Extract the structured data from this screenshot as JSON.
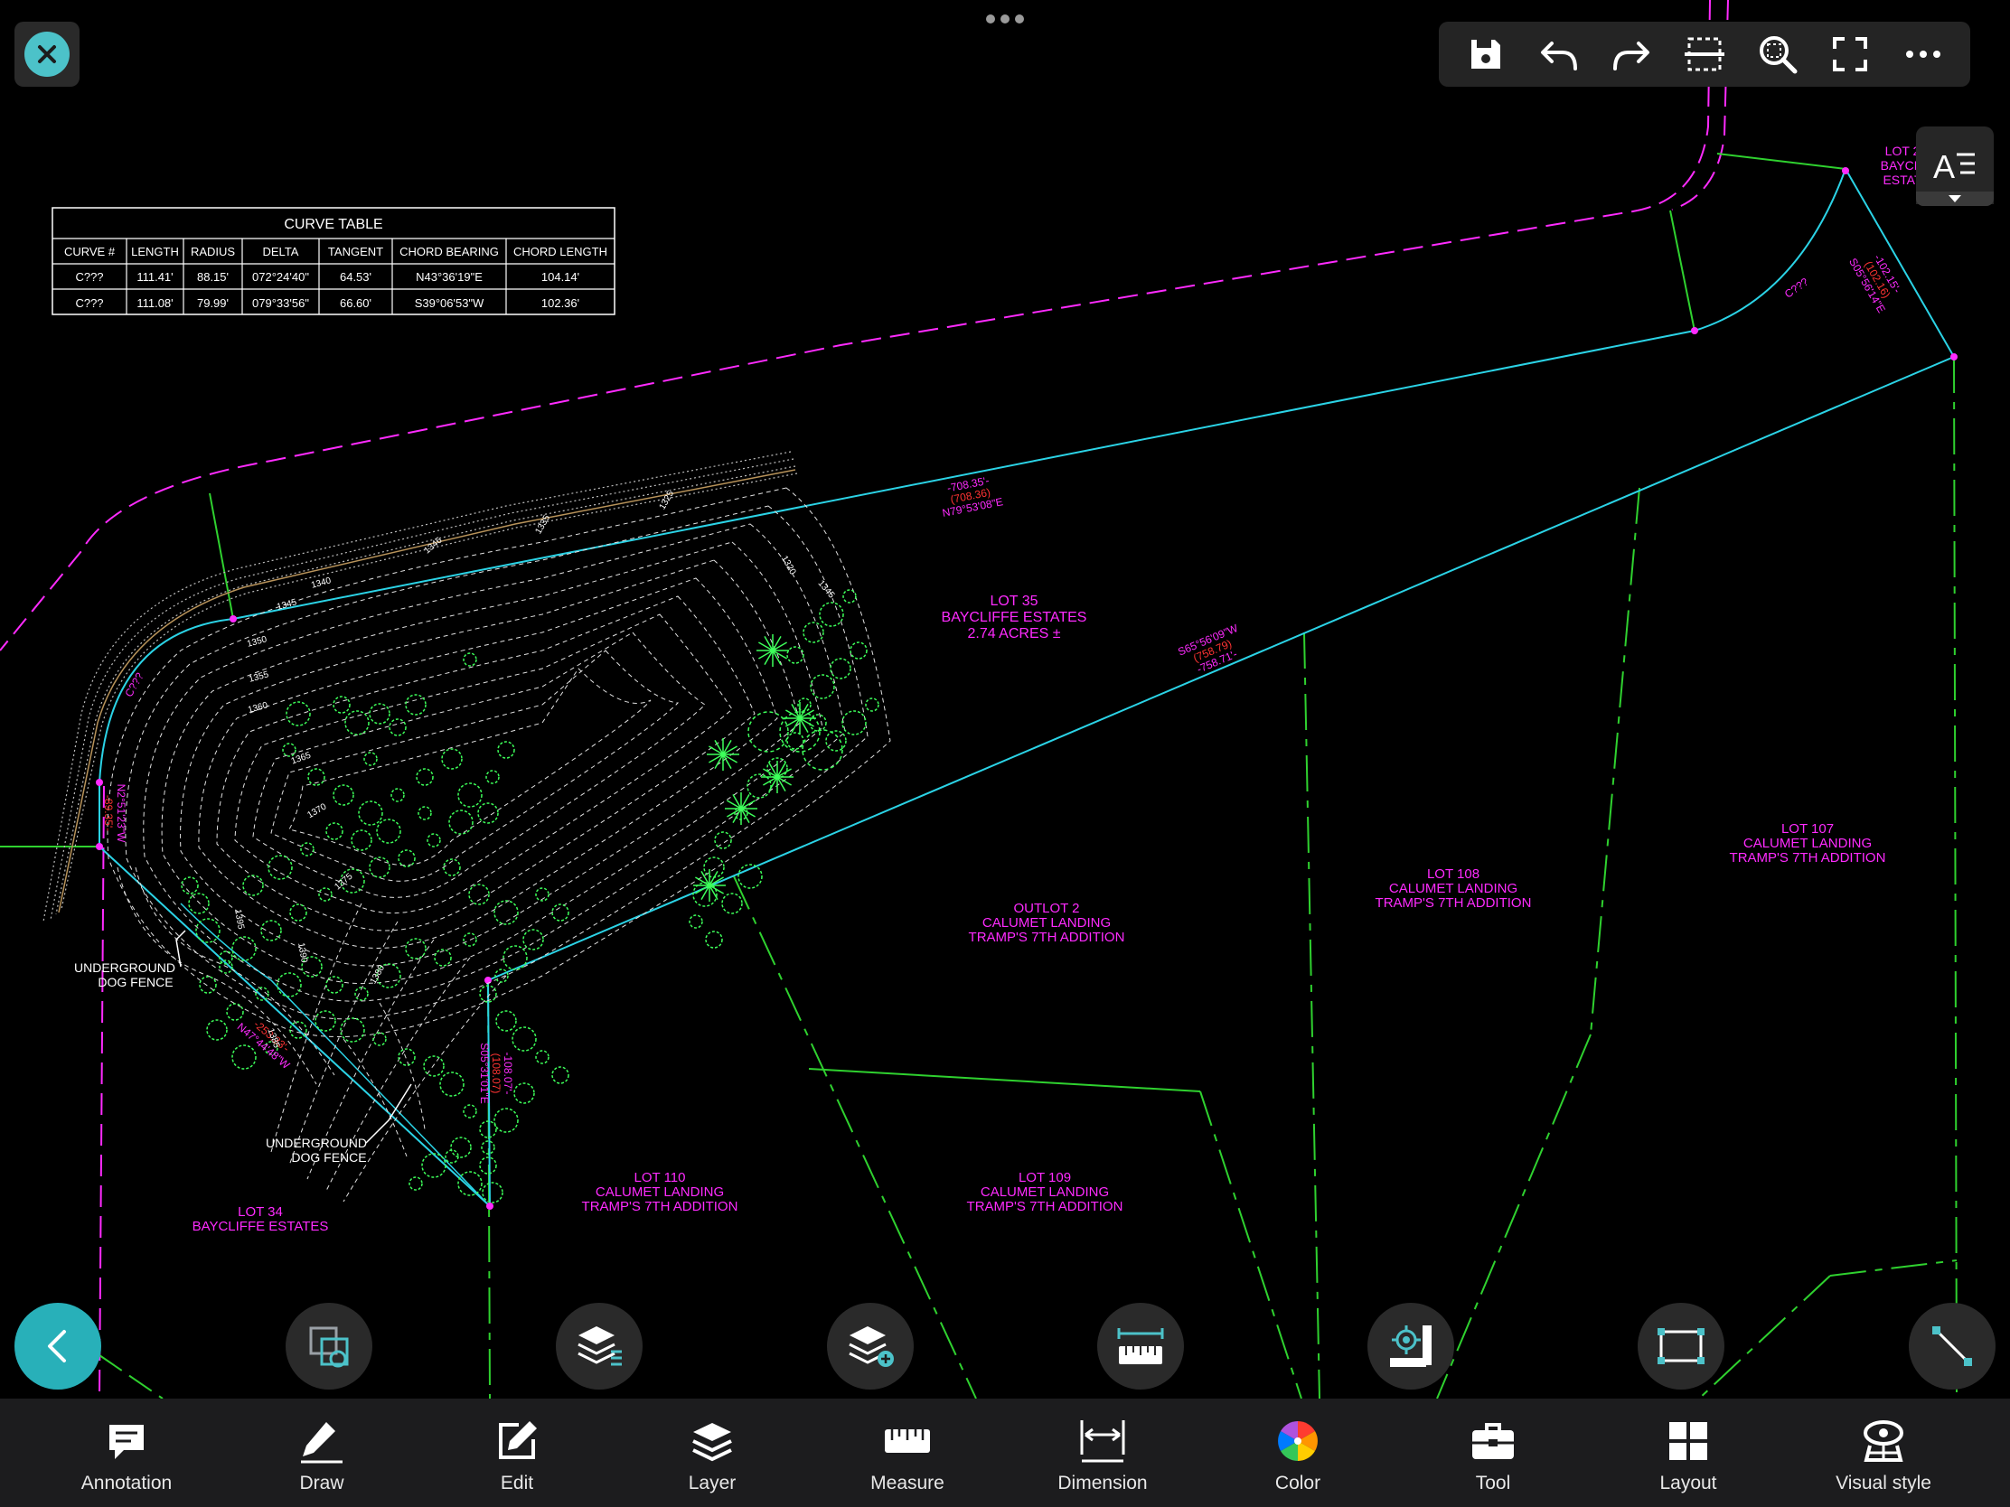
{
  "top_toolbar": {
    "buttons": [
      {
        "name": "save-button",
        "icon": "save-icon"
      },
      {
        "name": "undo-button",
        "icon": "undo-icon"
      },
      {
        "name": "redo-button",
        "icon": "redo-icon"
      },
      {
        "name": "trim-button",
        "icon": "trim-icon"
      },
      {
        "name": "zoom-extents-button",
        "icon": "zoom-icon"
      },
      {
        "name": "fullscreen-button",
        "icon": "fullscreen-icon"
      },
      {
        "name": "more-button",
        "icon": "more-icon"
      }
    ]
  },
  "curve_table": {
    "title": "CURVE TABLE",
    "headers": [
      "CURVE #",
      "LENGTH",
      "RADIUS",
      "DELTA",
      "TANGENT",
      "CHORD BEARING",
      "CHORD LENGTH"
    ],
    "rows": [
      [
        "C???",
        "111.41'",
        "88.15'",
        "072°24'40\"",
        "64.53'",
        "N43°36'19\"E",
        "104.14'"
      ],
      [
        "C???",
        "111.08'",
        "79.99'",
        "079°33'56\"",
        "66.60'",
        "S39°06'53\"W",
        "102.36'"
      ]
    ]
  },
  "labels": {
    "lot35": [
      "LOT 35",
      "BAYCLIFFE ESTATES",
      "2.74 ACRES ±"
    ],
    "lot34": [
      "LOT 34",
      "BAYCLIFFE ESTATES"
    ],
    "lot_top": [
      "LOT 2",
      "BAYCLI",
      "ESTAT"
    ],
    "outlot2": [
      "OUTLOT 2",
      "CALUMET LANDING",
      "TRAMP'S 7TH ADDITION"
    ],
    "lot108": [
      "LOT 108",
      "CALUMET LANDING",
      "TRAMP'S 7TH ADDITION"
    ],
    "lot107": [
      "LOT 107",
      "CALUMET LANDING",
      "TRAMP'S 7TH ADDITION"
    ],
    "lot110": [
      "LOT 110",
      "CALUMET LANDING",
      "TRAMP'S 7TH ADDITION"
    ],
    "lot109": [
      "LOT 109",
      "CALUMET LANDING",
      "TRAMP'S 7TH ADDITION"
    ],
    "fence1": [
      "UNDERGROUND",
      "DOG FENCE"
    ],
    "fence2": [
      "UNDERGROUND",
      "DOG FENCE"
    ],
    "curve1": "C???",
    "curve2": "C???",
    "dim_north": [
      "-708.35'-",
      "(708.36)",
      "N79°53'08\"E"
    ],
    "dim_south": [
      "S65°56'09\"W",
      "(758.79)",
      "-758.71'-"
    ],
    "dim_ne": [
      "-102.15'-",
      "(102.16)",
      "S05°56'14\"E"
    ],
    "dim_w": [
      "N2°51'23\"W",
      "-89.35'-"
    ],
    "dim_sw": [
      "-253.33'-",
      "N47°44'48\"W"
    ],
    "dim_s": [
      "-108.07'-",
      "(108.07)",
      "S05°31'01\"E"
    ],
    "contours": [
      "1345",
      "1340",
      "1350",
      "1355",
      "1360",
      "1365",
      "1370",
      "1375",
      "1380",
      "1385",
      "1390",
      "1395",
      "1335",
      "1325",
      "1320",
      "1345",
      "1346"
    ]
  },
  "floating_tools": [
    {
      "name": "select-objects-button",
      "icon": "select-icon"
    },
    {
      "name": "layer-manager-button",
      "icon": "layers-list-icon"
    },
    {
      "name": "add-layer-button",
      "icon": "layers-add-icon"
    },
    {
      "name": "quick-measure-button",
      "icon": "ruler-icon"
    },
    {
      "name": "settings-tool-button",
      "icon": "settings-ruler-icon"
    },
    {
      "name": "rectangle-button",
      "icon": "rectangle-icon"
    },
    {
      "name": "line-button",
      "icon": "line-icon"
    }
  ],
  "bottom_bar": [
    {
      "name": "annotation",
      "label": "Annotation",
      "icon": "annotation-icon"
    },
    {
      "name": "draw",
      "label": "Draw",
      "icon": "pencil-icon"
    },
    {
      "name": "edit",
      "label": "Edit",
      "icon": "edit-icon"
    },
    {
      "name": "layer",
      "label": "Layer",
      "icon": "layer-icon"
    },
    {
      "name": "measure",
      "label": "Measure",
      "icon": "measure-icon"
    },
    {
      "name": "dimension",
      "label": "Dimension",
      "icon": "dimension-icon"
    },
    {
      "name": "color",
      "label": "Color",
      "icon": "color-wheel-icon"
    },
    {
      "name": "tool",
      "label": "Tool",
      "icon": "toolbox-icon"
    },
    {
      "name": "layout",
      "label": "Layout",
      "icon": "layout-icon"
    },
    {
      "name": "visual-style",
      "label": "Visual style",
      "icon": "visual-style-icon"
    }
  ],
  "colors": {
    "background": "#000000",
    "magenta": "#ff2bff",
    "cyan": "#2bd3e6",
    "green": "#2fd12f",
    "tree_green": "#3dff5a",
    "accent": "#28b0b9",
    "toolbar": "#242424",
    "bottom_bar": "#1c1c1e"
  }
}
